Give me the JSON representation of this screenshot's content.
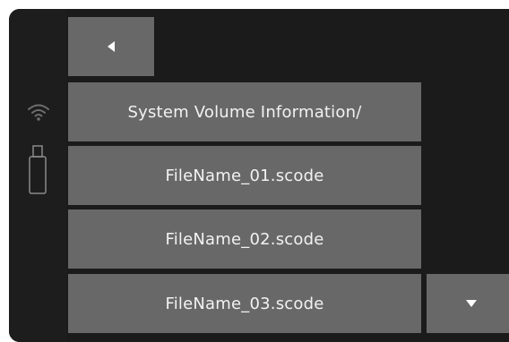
{
  "navigation": {
    "back_icon": "triangle-left-icon",
    "scroll_down_icon": "triangle-down-icon"
  },
  "status": {
    "wifi_icon": "wifi-icon",
    "usb_icon": "usb-drive-icon"
  },
  "file_list": {
    "items": [
      {
        "label": "System Volume Information/"
      },
      {
        "label": "FileName_01.scode"
      },
      {
        "label": "FileName_02.scode"
      },
      {
        "label": "FileName_03.scode"
      }
    ]
  },
  "colors": {
    "background": "#1d1d1d",
    "button": "#686868",
    "text": "#f2f2f2"
  }
}
